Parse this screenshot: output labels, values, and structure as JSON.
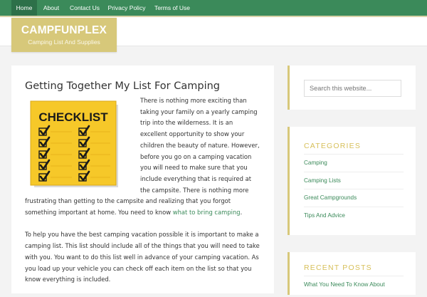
{
  "nav": {
    "items": [
      {
        "label": "Home",
        "active": true
      },
      {
        "label": "About"
      },
      {
        "label": "Contact Us"
      },
      {
        "label": "Privacy Policy"
      },
      {
        "label": "Terms of Use"
      }
    ]
  },
  "site": {
    "title": "CAMPFUNPLEX",
    "tagline": "Camping List And Supplies"
  },
  "post": {
    "title": "Getting Together My List For Camping",
    "image_text": "CHECKLIST",
    "para1_before_link": "There is nothing more exciting than taking your family on a yearly camping trip into the wilderness. It is an excellent opportunity to show your children the beauty of nature. However, before you go on a camping vacation you will need to make sure that you include everything that is required at the campsite. There is nothing more frustrating than getting to the campsite and realizing that you forgot something important at home. You need to know ",
    "para1_link": "what to bring camping",
    "para1_after_link": ".",
    "para2": "To help you have the best camping vacation possible it is important to make a camping list. This list should include all of the things that you will need to take with you. You want to do this list well in advance of your camping vacation. As you load up your vehicle you can check off each item on the list so that you know everything is included."
  },
  "sidebar": {
    "search_placeholder": "Search this website...",
    "categories_title": "CATEGORIES",
    "categories": [
      "Camping",
      "Camping Lists",
      "Great Campgrounds",
      "Tips And Advice"
    ],
    "recent_title": "RECENT POSTS",
    "recent": [
      "What You Need To Know About"
    ]
  },
  "colors": {
    "nav_bg": "#3b8a5a",
    "accent_gold": "#d7c87a",
    "link_green": "#3b8a5a",
    "widget_title": "#d7c05a"
  }
}
